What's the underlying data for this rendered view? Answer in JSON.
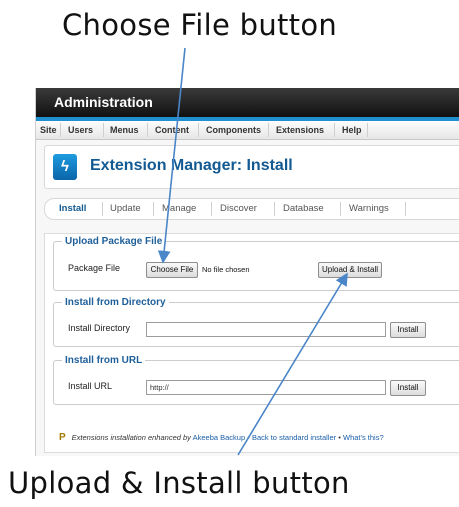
{
  "captions": {
    "top": "Choose File button",
    "bottom": "Upload & Install button"
  },
  "admin": {
    "title": "Administration"
  },
  "menu": {
    "items": [
      "Site",
      "Users",
      "Menus",
      "Content",
      "Components",
      "Extensions",
      "Help"
    ]
  },
  "header": {
    "title": "Extension Manager: Install"
  },
  "tabs": [
    "Install",
    "Update",
    "Manage",
    "Discover",
    "Database",
    "Warnings"
  ],
  "upload": {
    "legend": "Upload Package File",
    "label": "Package File",
    "choose_label": "Choose File",
    "no_file_text": "No file chosen",
    "submit_label": "Upload & Install"
  },
  "directory": {
    "legend": "Install from Directory",
    "label": "Install Directory",
    "value": "",
    "button": "Install"
  },
  "url": {
    "legend": "Install from URL",
    "label": "Install URL",
    "value": "http://",
    "button": "Install"
  },
  "footer": {
    "text_before": "Extensions installation enhanced by",
    "brand": "Akeeba Backup",
    "link_back": "Back to standard installer",
    "sep": "•",
    "link_whats": "What's this?"
  },
  "colors": {
    "accent_blue": "#1f8fd0",
    "title_blue": "#135a93",
    "arrow": "#4a86c8"
  }
}
